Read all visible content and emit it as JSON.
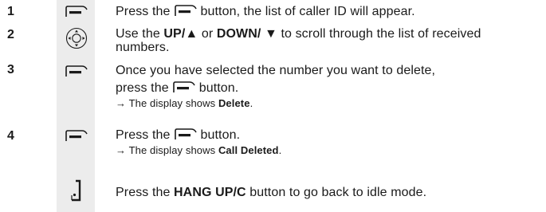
{
  "steps": [
    {
      "number": "1",
      "icon": "menu-key-icon",
      "text_before": "Press the",
      "text_after": "button, the list of caller ID will appear."
    },
    {
      "number": "2",
      "icon": "navigation-key-icon",
      "line1_a": "Use the ",
      "line1_b": "UP/▲",
      "line1_c": " or ",
      "line1_d": "DOWN/ ▼",
      "line1_e": " to scroll through the list of received",
      "line2": "numbers."
    },
    {
      "number": "3",
      "icon": "menu-key-icon",
      "line1": "Once you have selected the number you want to delete,",
      "line2_before": "press the",
      "line2_after": "button.",
      "result_prefix": "→ The display shows ",
      "result_value": "Delete",
      "result_suffix": "."
    },
    {
      "number": "4",
      "icon": "menu-key-icon",
      "line1_before": "Press the",
      "line1_after": "button.",
      "result_prefix": "→ The display shows ",
      "result_value": "Call Deleted",
      "result_suffix": "."
    },
    {
      "number": "",
      "icon": "hang-up-key-icon",
      "text_before": "Press the ",
      "button_name": "HANG UP/C",
      "text_after": " button to go back to idle mode."
    }
  ]
}
